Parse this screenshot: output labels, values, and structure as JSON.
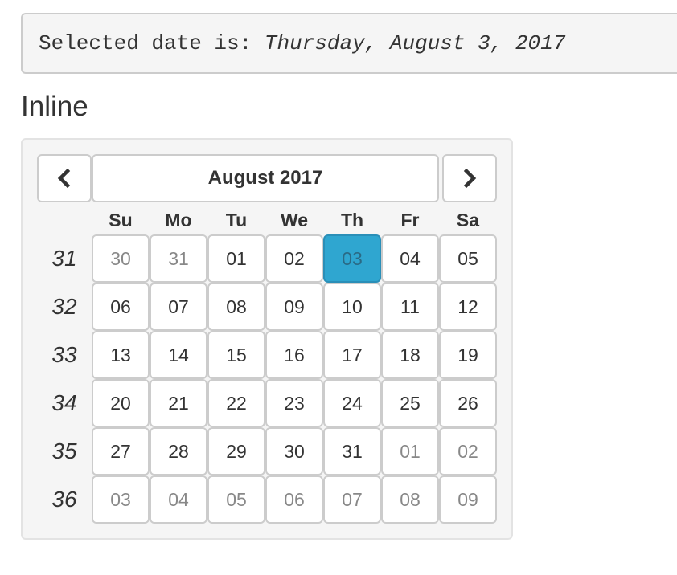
{
  "selected": {
    "prefix": "Selected date is:",
    "date_text": "Thursday, August 3, 2017"
  },
  "section_heading": "Inline",
  "calendar": {
    "month_label": "August 2017",
    "prev_icon": "chevron-left-icon",
    "next_icon": "chevron-right-icon",
    "weekday_headers": [
      "Su",
      "Mo",
      "Tu",
      "We",
      "Th",
      "Fr",
      "Sa"
    ],
    "selected_day": "03",
    "accent_color": "#2fa6d0",
    "rows": [
      {
        "week": "31",
        "days": [
          {
            "label": "30",
            "muted": true
          },
          {
            "label": "31",
            "muted": true
          },
          {
            "label": "01"
          },
          {
            "label": "02"
          },
          {
            "label": "03",
            "active": true
          },
          {
            "label": "04"
          },
          {
            "label": "05"
          }
        ]
      },
      {
        "week": "32",
        "days": [
          {
            "label": "06"
          },
          {
            "label": "07"
          },
          {
            "label": "08"
          },
          {
            "label": "09"
          },
          {
            "label": "10"
          },
          {
            "label": "11"
          },
          {
            "label": "12"
          }
        ]
      },
      {
        "week": "33",
        "days": [
          {
            "label": "13"
          },
          {
            "label": "14"
          },
          {
            "label": "15"
          },
          {
            "label": "16"
          },
          {
            "label": "17"
          },
          {
            "label": "18"
          },
          {
            "label": "19"
          }
        ]
      },
      {
        "week": "34",
        "days": [
          {
            "label": "20"
          },
          {
            "label": "21"
          },
          {
            "label": "22"
          },
          {
            "label": "23"
          },
          {
            "label": "24"
          },
          {
            "label": "25"
          },
          {
            "label": "26"
          }
        ]
      },
      {
        "week": "35",
        "days": [
          {
            "label": "27"
          },
          {
            "label": "28"
          },
          {
            "label": "29"
          },
          {
            "label": "30"
          },
          {
            "label": "31"
          },
          {
            "label": "01",
            "muted": true
          },
          {
            "label": "02",
            "muted": true
          }
        ]
      },
      {
        "week": "36",
        "days": [
          {
            "label": "03",
            "muted": true
          },
          {
            "label": "04",
            "muted": true
          },
          {
            "label": "05",
            "muted": true
          },
          {
            "label": "06",
            "muted": true
          },
          {
            "label": "07",
            "muted": true
          },
          {
            "label": "08",
            "muted": true
          },
          {
            "label": "09",
            "muted": true
          }
        ]
      }
    ]
  }
}
